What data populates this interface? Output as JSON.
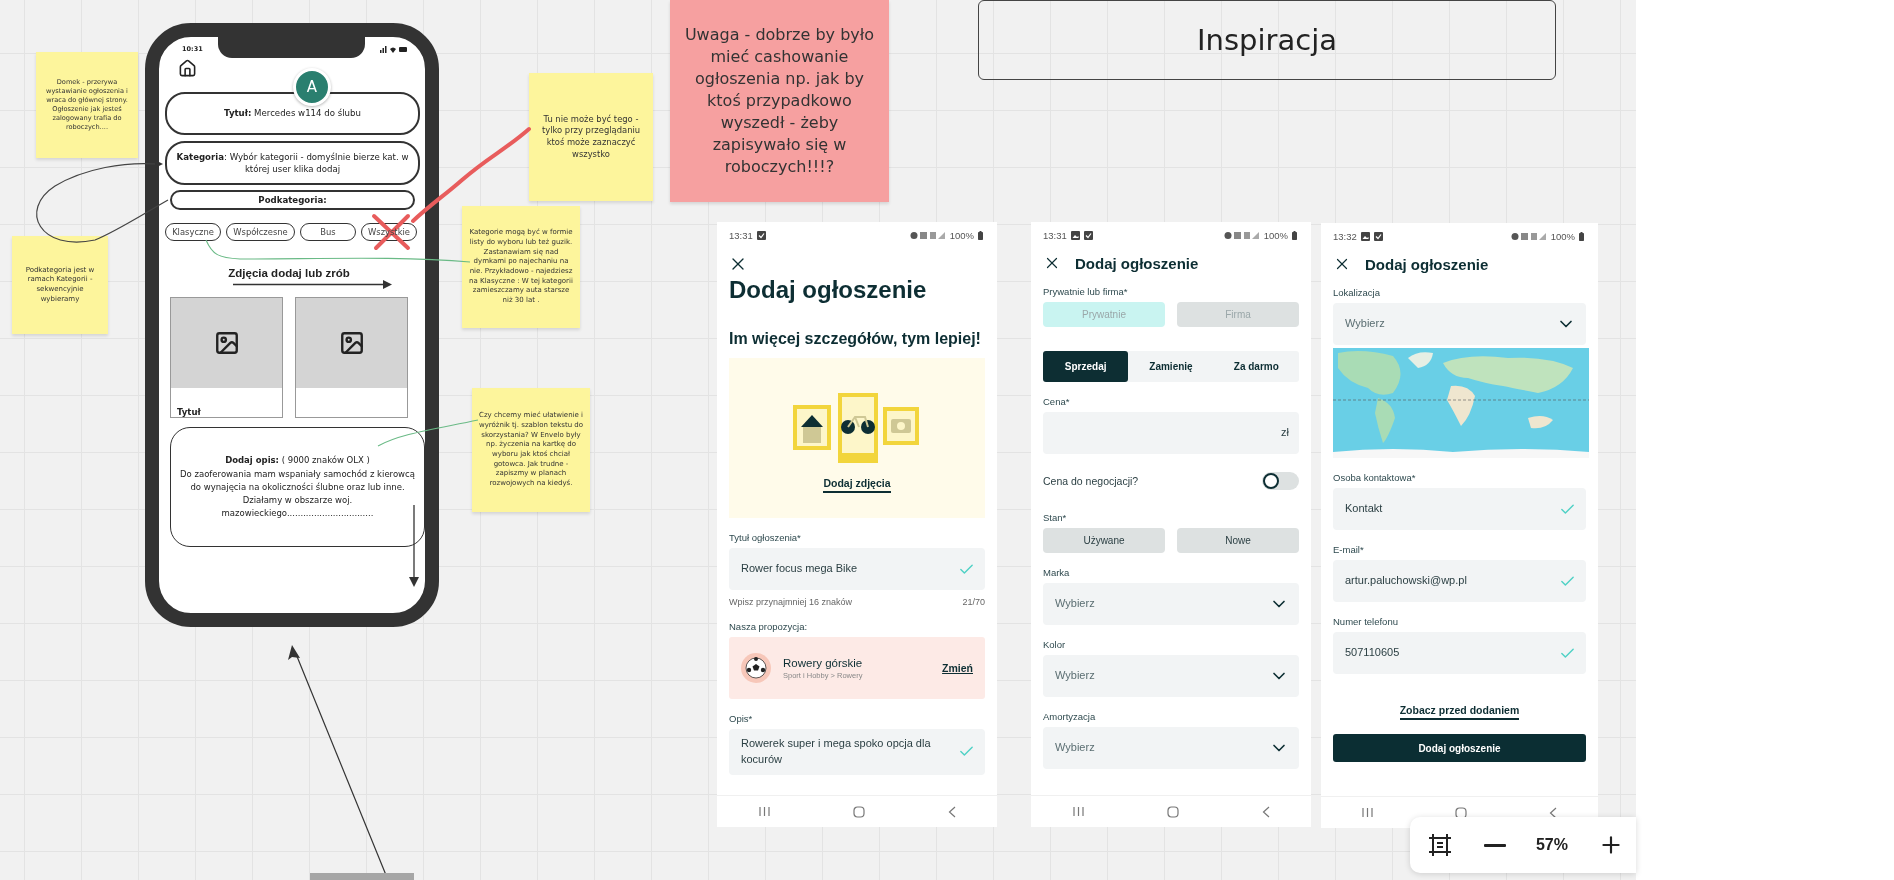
{
  "notes": [
    {
      "text": "Domek - przerywa wystawianie ogłoszenia i wraca do głównej strony. Ogłoszenie jak jesteś zalogowany trafia do roboczych....",
      "color": "#fdf59c"
    },
    {
      "text": "Podkategoria jest w ramach Kategorii - sekwencyjnie wybieramy",
      "color": "#fdf59c"
    },
    {
      "text": "Tu nie może być tego - tylko przy przeglądaniu ktoś może zaznaczyć wszystko",
      "color": "#fdf59c"
    },
    {
      "text": "Uwaga - dobrze by było mieć cashowanie ogłoszenia np. jak by ktoś przypadkowo wyszedł - żeby zapisywało się w roboczych!!!?",
      "color": "#f6a0a0"
    },
    {
      "text": "Kategorie mogą być w formie listy do wyboru lub też guzik.  Zastanawiam się nad dymkami po najechaniu na nie. Przykładowo - najedziesz na Klasyczne :  W tej kategorii zamieszczamy auta starsze niż 30 lat .",
      "color": "#fdf59c"
    },
    {
      "text": "Czy chcemy mieć ułatwienie i wyróżnik tj. szablon tekstu do skorzystania? W Envelo były np. życzenia na kartkę do wyboru jak ktoś chciał gotowca. Jak trudne - zapiszmy w planach rozwojowych na kiedyś.",
      "color": "#fdf59c"
    }
  ],
  "frame_title": "Inspiracja",
  "wireframe": {
    "time": "10:31",
    "avatar": "A",
    "title_field": "**Tytuł:** Mercedes w114 do ślubu",
    "category_field": "**Kategoria**:  Wybór kategorii - domyślnie bierze kat. w której user klika dodaj",
    "subcategory_field": "Podkategoria:",
    "chips": [
      {
        "label": "Klasyczne",
        "crossed": false
      },
      {
        "label": "Współczesne",
        "crossed": false
      },
      {
        "label": "Bus",
        "crossed": false
      },
      {
        "label": "Wszystkie",
        "crossed": true
      }
    ],
    "photos_heading": "Zdjęcia dodaj lub zrób",
    "photos": [
      {
        "kind": "captioned",
        "caption": "Tytuł"
      },
      {
        "kind": "plain"
      }
    ],
    "description_heading": "**Dodaj opis:**  ( 9000 znaków OLX )",
    "description": "Do zaoferowania mam wspaniały samochód z kierowcą do wynajęcia na okoliczności ślubne oraz lub inne. Działamy w obszarze woj. mazowieckiego................................"
  },
  "screenshots": [
    {
      "time": "13:31",
      "image_notification": false,
      "battery": "100%",
      "header": {
        "kind": "large",
        "title": "Dodaj ogłoszenie"
      },
      "items": [
        {
          "kind": "subtitle",
          "text": "Im więcej szczegółów, tym lepiej!"
        },
        {
          "kind": "photos",
          "link": "Dodaj zdjęcia"
        },
        {
          "kind": "label",
          "text": "Tytuł ogłoszenia*"
        },
        {
          "kind": "input",
          "value": "Rower focus mega Bike",
          "valid": true
        },
        {
          "kind": "helper",
          "text": "Wpisz przynajmniej 16 znaków",
          "count": "21/70"
        },
        {
          "kind": "label",
          "text": "Nasza propozycja:"
        },
        {
          "kind": "suggestion",
          "title": "Rowery górskie",
          "path": "Sport i Hobby > Rowery",
          "action": "Zmień"
        },
        {
          "kind": "label",
          "text": "Opis*"
        },
        {
          "kind": "input",
          "value": "Rowerek super i mega spoko opcja dla kocurów",
          "valid": true
        }
      ]
    },
    {
      "time": "13:31",
      "image_notification": true,
      "battery": "100%",
      "header": {
        "kind": "inline",
        "title": "Dodaj ogłoszenie"
      },
      "items": [
        {
          "kind": "label",
          "text": "Prywatnie lub firma*"
        },
        {
          "kind": "choices",
          "disabled": true,
          "options": [
            {
              "label": "Prywatnie",
              "selected": true
            },
            {
              "label": "Firma",
              "selected": false
            }
          ]
        },
        {
          "kind": "segmented",
          "options": [
            {
              "label": "Sprzedaj",
              "selected": true
            },
            {
              "label": "Zamienię",
              "selected": false
            },
            {
              "label": "Za darmo",
              "selected": false
            }
          ]
        },
        {
          "kind": "label",
          "text": "Cena*"
        },
        {
          "kind": "input",
          "suffix": "zł",
          "valid": false
        },
        {
          "kind": "toggle",
          "label": "Cena do negocjacji?",
          "on": false
        },
        {
          "kind": "label",
          "text": "Stan*"
        },
        {
          "kind": "choices",
          "disabled": false,
          "options": [
            {
              "label": "Używane",
              "selected": false
            },
            {
              "label": "Nowe",
              "selected": false
            }
          ]
        },
        {
          "kind": "label",
          "text": "Marka"
        },
        {
          "kind": "select",
          "value": "Wybierz"
        },
        {
          "kind": "label",
          "text": "Kolor"
        },
        {
          "kind": "select",
          "value": "Wybierz"
        },
        {
          "kind": "label",
          "text": "Amortyzacja"
        },
        {
          "kind": "select",
          "value": "Wybierz"
        }
      ]
    },
    {
      "time": "13:32",
      "image_notification": true,
      "battery": "100%",
      "header": {
        "kind": "inline",
        "title": "Dodaj ogłoszenie"
      },
      "items": [
        {
          "kind": "label",
          "text": "Lokalizacja"
        },
        {
          "kind": "select",
          "value": "Wybierz"
        },
        {
          "kind": "map"
        },
        {
          "kind": "label",
          "text": "Osoba kontaktowa*"
        },
        {
          "kind": "input",
          "value": "Kontakt",
          "valid": true
        },
        {
          "kind": "label",
          "text": "E-mail*"
        },
        {
          "kind": "input",
          "value": "artur.paluchowski@wp.pl",
          "valid": true
        },
        {
          "kind": "label",
          "text": "Numer telefonu"
        },
        {
          "kind": "input",
          "value": "507110605",
          "valid": true
        },
        {
          "kind": "link",
          "text": "Zobacz przed dodaniem"
        },
        {
          "kind": "primary_button",
          "text": "Dodaj ogłoszenie"
        }
      ]
    }
  ],
  "zoom": {
    "level": "57%"
  }
}
